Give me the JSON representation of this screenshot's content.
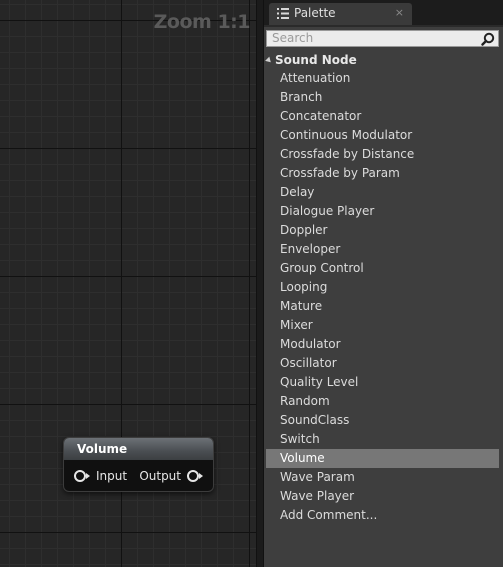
{
  "graph": {
    "zoom_label": "Zoom 1:1",
    "node": {
      "title": "Volume",
      "input_label": "Input",
      "output_label": "Output"
    }
  },
  "palette": {
    "tab_title": "Palette",
    "tab_close": "×",
    "search_placeholder": "Search",
    "category_label": "Sound Node",
    "items": [
      "Attenuation",
      "Branch",
      "Concatenator",
      "Continuous Modulator",
      "Crossfade by Distance",
      "Crossfade by Param",
      "Delay",
      "Dialogue Player",
      "Doppler",
      "Enveloper",
      "Group Control",
      "Looping",
      "Mature",
      "Mixer",
      "Modulator",
      "Oscillator",
      "Quality Level",
      "Random",
      "SoundClass",
      "Switch",
      "Volume",
      "Wave Param",
      "Wave Player",
      "Add Comment..."
    ],
    "selected_item": "Volume"
  }
}
